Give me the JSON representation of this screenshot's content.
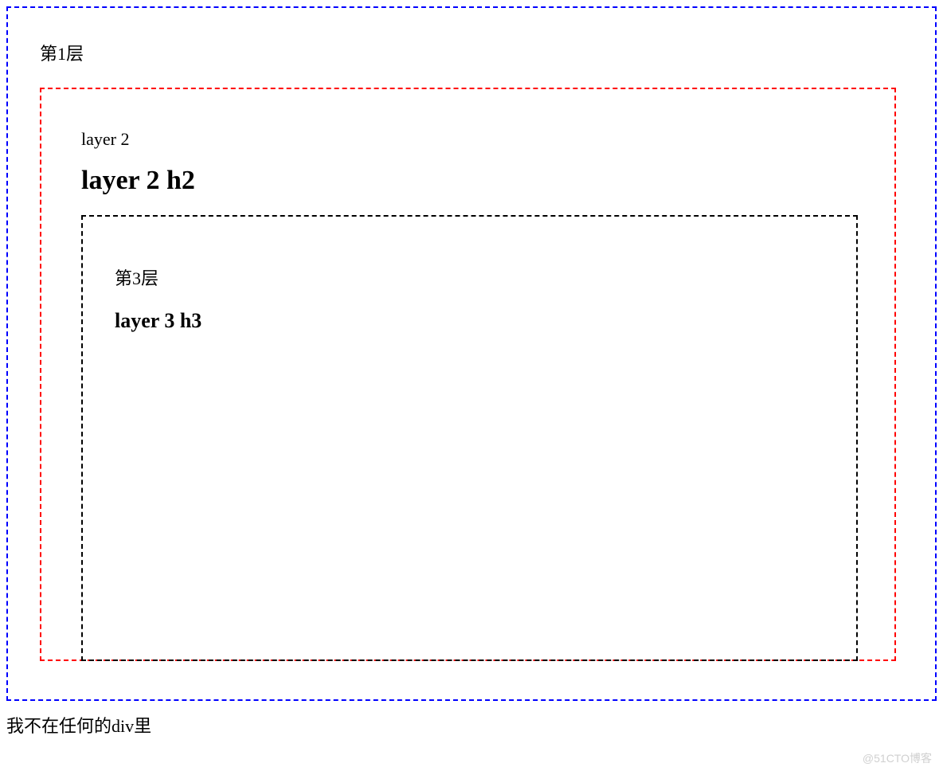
{
  "layer1": {
    "label": "第1层"
  },
  "layer2": {
    "label": "layer 2",
    "heading": "layer 2 h2"
  },
  "layer3": {
    "label": "第3层",
    "heading": "layer 3 h3"
  },
  "outside_text": "我不在任何的div里",
  "watermark": "@51CTO博客"
}
